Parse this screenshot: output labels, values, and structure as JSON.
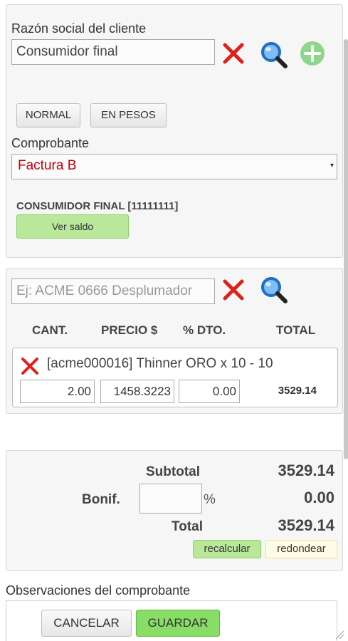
{
  "client": {
    "label": "Razón social del cliente",
    "value": "Consumidor final",
    "normal_button": "NORMAL",
    "pesos_button": "EN PESOS",
    "comprobante_label": "Comprobante",
    "comprobante_value": "Factura B",
    "client_info": "CONSUMIDOR FINAL [11111111]",
    "ver_saldo_button": "Ver saldo"
  },
  "items": {
    "search_placeholder": "Ej: ACME 0666 Desplumador",
    "columns": [
      "CANT.",
      "PRECIO $",
      "% DTO.",
      "TOTAL"
    ],
    "rows": [
      {
        "description": "[acme000016] Thinner ORO x 10 -  10",
        "quantity": "2.00",
        "price": "1458.3223",
        "discount": "0.00",
        "total": "3529.14"
      }
    ]
  },
  "totals": {
    "subtotal_label": "Subtotal",
    "subtotal_value": "3529.14",
    "bonif_label": "Bonif.",
    "bonif_input": "",
    "percent_sign": "%",
    "bonif_value": "0.00",
    "total_label": "Total",
    "total_value": "3529.14",
    "recalcular_button": "recalcular",
    "redondear_button": "redondear"
  },
  "observaciones": {
    "label": "Observaciones del comprobante",
    "value": ""
  },
  "actions": {
    "cancel_button": "CANCELAR",
    "save_button": "GUARDAR"
  },
  "colors": {
    "accent_red": "#e0201a",
    "search_blue": "#2e7fd6",
    "add_green": "#8fd68a",
    "button_green": "#b9e89a",
    "comprobante_text": "#c0000a"
  }
}
